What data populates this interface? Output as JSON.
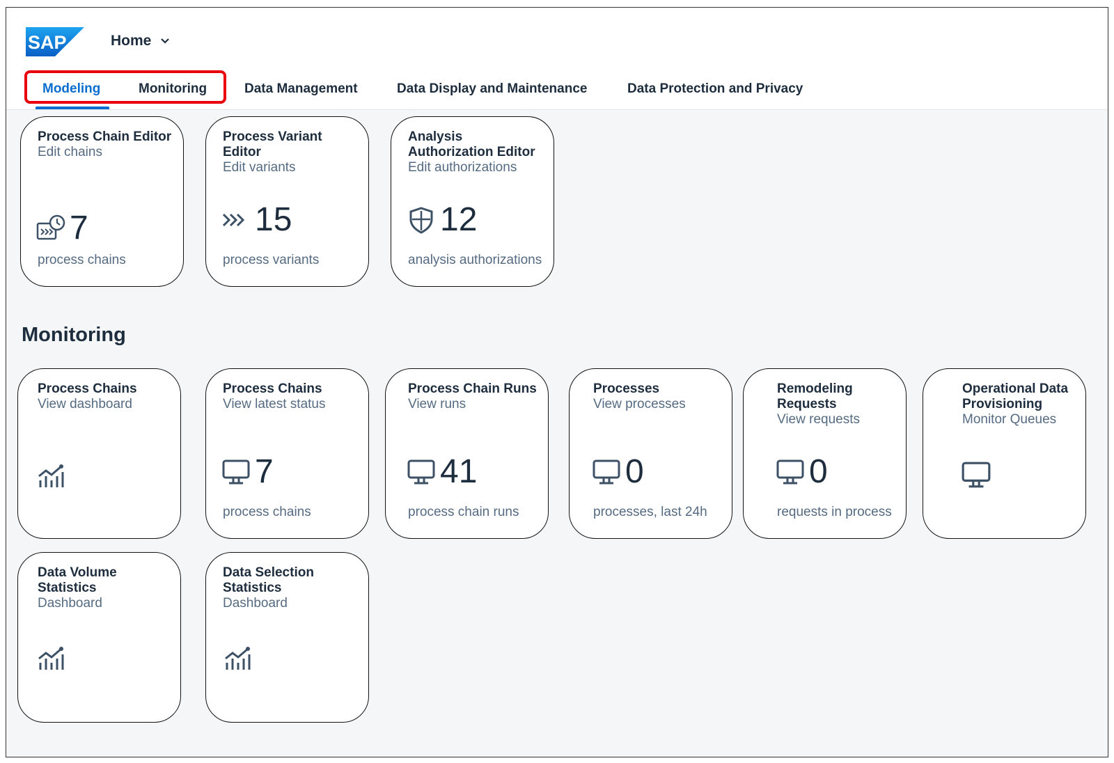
{
  "shell": {
    "logo_text": "SAP",
    "home_label": "Home"
  },
  "tabs": [
    {
      "label": "Modeling"
    },
    {
      "label": "Monitoring"
    },
    {
      "label": "Data Management"
    },
    {
      "label": "Data Display and Maintenance"
    },
    {
      "label": "Data Protection and Privacy"
    }
  ],
  "modeling": {
    "tiles": [
      {
        "title": "Process Chain Editor",
        "subtitle": "Edit chains",
        "value": "7",
        "footer": "process chains",
        "icon": "process-chain-icon"
      },
      {
        "title": "Process Variant Editor",
        "subtitle": "Edit variants",
        "value": "15",
        "footer": "process variants",
        "icon": "forward-arrows-icon"
      },
      {
        "title": "Analysis Authorization Editor",
        "subtitle": "Edit authorizations",
        "value": "12",
        "footer": "analysis authorizations",
        "icon": "shield-icon"
      }
    ]
  },
  "monitoring": {
    "title": "Monitoring",
    "tiles": [
      {
        "title": "Process Chains",
        "subtitle": "View dashboard",
        "icon": "trend-chart-icon"
      },
      {
        "title": "Process Chains",
        "subtitle": "View latest status",
        "value": "7",
        "footer": "process chains",
        "icon": "monitor-icon"
      },
      {
        "title": "Process Chain Runs",
        "subtitle": "View runs",
        "value": "41",
        "footer": "process chain runs",
        "icon": "monitor-icon"
      },
      {
        "title": "Processes",
        "subtitle": "View processes",
        "value": "0",
        "footer": "processes, last 24h",
        "icon": "monitor-icon"
      },
      {
        "title": "Remodeling Requests",
        "subtitle": "View requests",
        "value": "0",
        "footer": "requests in process",
        "icon": "monitor-icon"
      },
      {
        "title": "Operational Data Provisioning",
        "subtitle": "Monitor Queues",
        "icon": "monitor-icon"
      },
      {
        "title": "Data Volume Statistics",
        "subtitle": "Dashboard",
        "icon": "trend-chart-icon"
      },
      {
        "title": "Data Selection Statistics",
        "subtitle": "Dashboard",
        "icon": "trend-chart-icon"
      }
    ]
  },
  "colors": {
    "accent": "#0a6ed1",
    "highlight": "#e8000d",
    "text": "#1d2d3e",
    "subtext": "#556b82"
  }
}
